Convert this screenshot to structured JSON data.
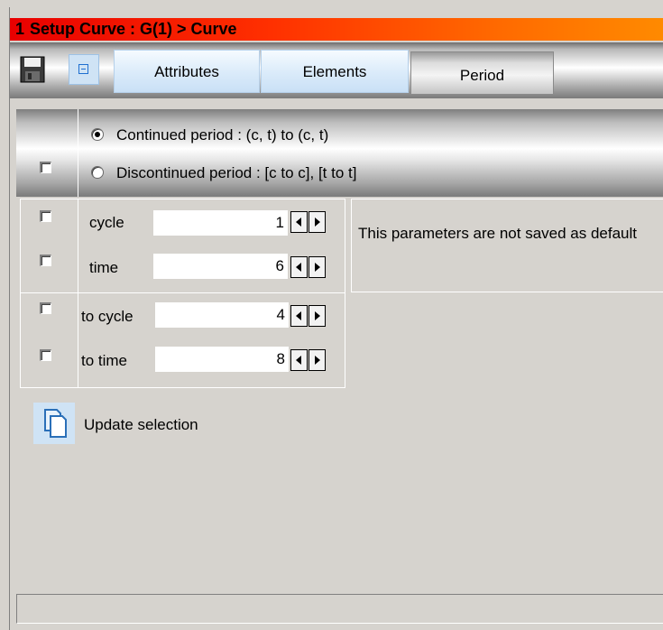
{
  "title": {
    "number": "1",
    "text": "Setup Curve : G(1) > Curve"
  },
  "toolbar": {
    "save_icon": "floppy-disk-icon",
    "collapse_icon": "collapse-minus-icon",
    "tabs": [
      {
        "label": "Attributes"
      },
      {
        "label": "Elements"
      },
      {
        "label": "Period"
      }
    ],
    "active_tab": "Period"
  },
  "period": {
    "continued_label": "Continued period : (c, t) to (c, t)",
    "continued_selected": true,
    "discontinued_label": "Discontinued period : [c to c], [t to t]",
    "discontinued_selected": false
  },
  "params": {
    "cycle_label": "cycle",
    "cycle_value": "1",
    "time_label": "time",
    "time_value": "6",
    "to_cycle_label": "to cycle",
    "to_cycle_value": "4",
    "to_time_label": "to time",
    "to_time_value": "8",
    "info": "This parameters are not saved as default"
  },
  "actions": {
    "update_label": "Update selection",
    "update_icon": "copy-pages-icon"
  },
  "colors": {
    "title_gradient_start": "#e80000",
    "title_gradient_end": "#ff8a00",
    "window_bg": "#d6d3ce",
    "tab_inactive": "#dcecfa"
  }
}
